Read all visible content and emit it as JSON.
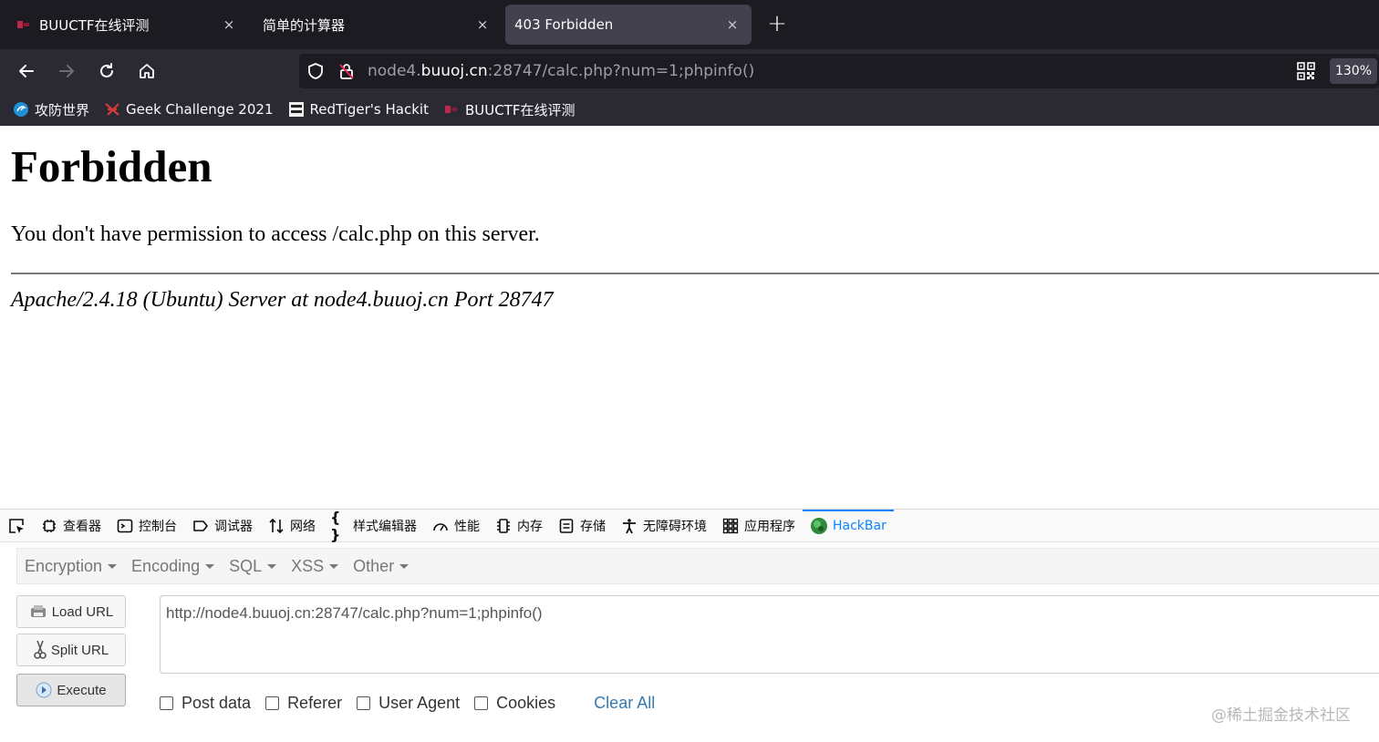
{
  "tabs": [
    {
      "title": "BUUCTF在线评测",
      "close": "×"
    },
    {
      "title": "简单的计算器",
      "close": "×"
    },
    {
      "title": "403 Forbidden",
      "close": "×",
      "active": true
    }
  ],
  "new_tab_label": "+",
  "url": {
    "prefix": "node4.",
    "host": "buuoj.cn",
    "rest": ":28747/calc.php?num=1;phpinfo()"
  },
  "zoom": "130%",
  "bookmarks": [
    {
      "label": "攻防世界",
      "icon": "adworld-icon"
    },
    {
      "label": "Geek Challenge 2021",
      "icon": "geek-icon"
    },
    {
      "label": "RedTiger's Hackit",
      "icon": "hackit-icon"
    },
    {
      "label": "BUUCTF在线评测",
      "icon": "buuctf-icon"
    }
  ],
  "page": {
    "heading": "Forbidden",
    "message": "You don't have permission to access /calc.php on this server.",
    "server": "Apache/2.4.18 (Ubuntu) Server at node4.buuoj.cn Port 28747"
  },
  "devtools": {
    "tabs": [
      {
        "label": "查看器",
        "icon": "inspector-icon"
      },
      {
        "label": "控制台",
        "icon": "console-icon"
      },
      {
        "label": "调试器",
        "icon": "debugger-icon"
      },
      {
        "label": "网络",
        "icon": "network-icon"
      },
      {
        "label": "样式编辑器",
        "icon": "style-editor-icon"
      },
      {
        "label": "性能",
        "icon": "performance-icon"
      },
      {
        "label": "内存",
        "icon": "memory-icon"
      },
      {
        "label": "存储",
        "icon": "storage-icon"
      },
      {
        "label": "无障碍环境",
        "icon": "accessibility-icon"
      },
      {
        "label": "应用程序",
        "icon": "application-icon"
      },
      {
        "label": "HackBar",
        "icon": "hackbar-icon",
        "active": true
      }
    ]
  },
  "hackbar": {
    "menu": [
      "Encryption",
      "Encoding",
      "SQL",
      "XSS",
      "Other"
    ],
    "load_url": "Load URL",
    "split_url": "Split URL",
    "execute": "Execute",
    "url_value": "http://node4.buuoj.cn:28747/calc.php?num=1;phpinfo()",
    "options": [
      "Post data",
      "Referer",
      "User Agent",
      "Cookies"
    ],
    "clear_all": "Clear All"
  },
  "watermark": "@稀土掘金技术社区",
  "colors": {
    "tab_bg": "#1c1b22",
    "toolbar_bg": "#2b2a33",
    "active_tab": "#42414d",
    "accent": "#0a84ff",
    "link": "#337ab7"
  }
}
